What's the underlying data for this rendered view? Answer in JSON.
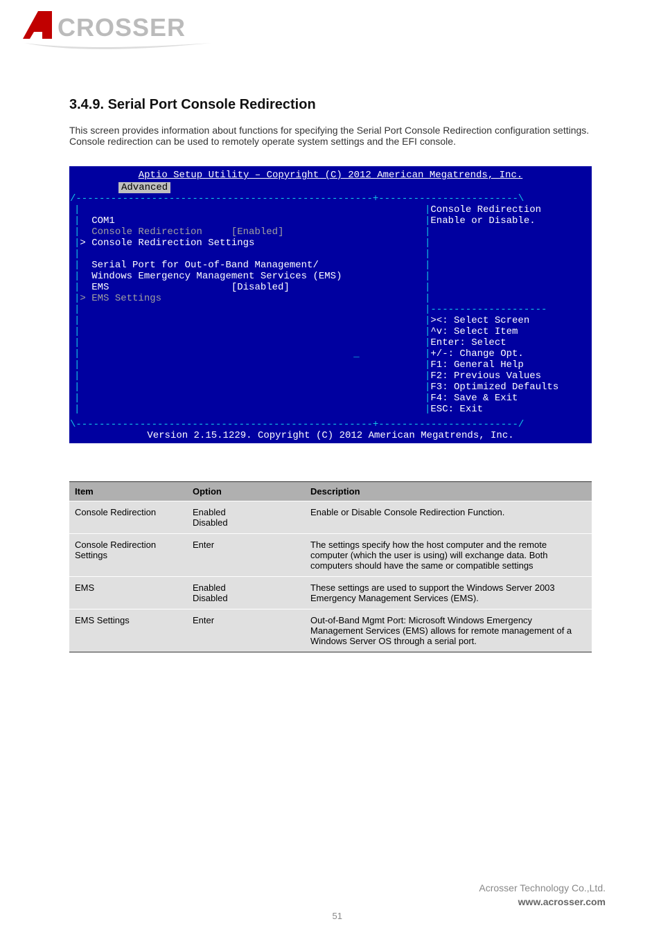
{
  "logo_text": "ACROSSER",
  "heading": "3.4.9. Serial Port Console Redirection",
  "subheading": "This screen provides information about functions for specifying the Serial Port Console Redirection configuration settings. Console redirection can be used to remotely operate system settings and the EFI console.",
  "bios": {
    "title": "Aptio Setup Utility – Copyright (C) 2012 American Megatrends, Inc.",
    "tab": " Advanced ",
    "top_div": "/---------------------------------------------------+------------------------\\",
    "mid_div": "|                                                   +------------------------|",
    "bot_div": "\\---------------------------------------------------+------------------------/",
    "left_lines": [
      "|",
      "|  COM1",
      "|  Console Redirection     [Enabled]",
      "|> Console Redirection Settings",
      "|",
      "|  Serial Port for Out-of-Band Management/",
      "|  Windows Emergency Management Services (EMS)",
      "|  EMS                     [Disabled]",
      "|> EMS Settings",
      "|",
      "|",
      "|",
      "|",
      "|                                               _",
      "|",
      "|",
      "|",
      "|",
      "|"
    ],
    "left_classes": [
      "cyan",
      "white",
      "hlrow",
      "white",
      "cyan",
      "white",
      "white",
      "white",
      "gray",
      "cyan",
      "cyan",
      "cyan",
      "cyan",
      "cyan",
      "cyan",
      "cyan",
      "cyan",
      "cyan",
      "cyan"
    ],
    "right_block1": [
      "|Console Redirection",
      "|Enable or Disable.",
      "|",
      "|",
      "|",
      "|",
      "|",
      "|",
      "|"
    ],
    "right_block2_div": "|--------------------",
    "right_block2": [
      "|><: Select Screen",
      "|^v: Select Item",
      "|Enter: Select",
      "|+/-: Change Opt.",
      "|F1: General Help",
      "|F2: Previous Values",
      "|F3: Optimized Defaults",
      "|F4: Save & Exit",
      "|ESC: Exit"
    ],
    "footer": "Version 2.15.1229. Copyright (C) 2012 American Megatrends, Inc."
  },
  "table": {
    "headers": [
      "Item",
      "Option",
      "Description"
    ],
    "rows": [
      {
        "item": "Console Redirection",
        "option": "Enabled\nDisabled",
        "desc": "Enable or Disable Console Redirection Function."
      },
      {
        "item": "Console Redirection Settings",
        "option": "Enter",
        "desc": "The settings specify how the host computer and the remote computer (which the user is using) will exchange data. Both computers should have the same or compatible settings"
      },
      {
        "item": "EMS",
        "option": "Enabled\nDisabled",
        "desc": "These settings are used to support the Windows Server 2003 Emergency Management Services (EMS)."
      },
      {
        "item": "EMS Settings",
        "option": "Enter",
        "desc": "Out-of-Band Mgmt Port: Microsoft Windows Emergency Management Services (EMS) allows for remote management of a Windows Server OS through a serial port."
      }
    ]
  },
  "footer": {
    "company": "Acrosser Technology Co.,Ltd.",
    "website": "www.acrosser.com",
    "page": "51"
  }
}
